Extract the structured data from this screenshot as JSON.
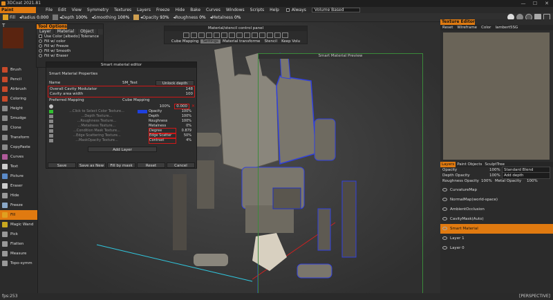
{
  "window": {
    "title": "3DCoat 2021.81",
    "min": "—",
    "max": "☐",
    "close": "✕"
  },
  "menu": {
    "room": "Paint",
    "items": [
      "File",
      "Edit",
      "View",
      "Symmetry",
      "Textures",
      "Layers",
      "Freeze",
      "Hide",
      "Bake",
      "Curves",
      "Windows",
      "Scripts",
      "Help"
    ],
    "always_label": "Always",
    "volume_select": "Volume Based"
  },
  "toolbar": {
    "fill": "Fill",
    "radius_label": "Radius",
    "radius_value": "0.000",
    "depth_label": "Depth",
    "depth_value": "100%",
    "smoothing_label": "Smoothing",
    "smoothing_value": "100%",
    "opacity_label": "Opacity",
    "opacity_value": "93%",
    "roughness_label": "Roughness",
    "roughness_value": "0%",
    "metalness_label": "Metalness",
    "metalness_value": "0%",
    "colors": {
      "accent": "#e07a10"
    }
  },
  "tool_options": {
    "header": "Tool Options",
    "tabs": [
      "Layer",
      "Material",
      "Object"
    ],
    "options": [
      {
        "kind": "checkbox",
        "label": "Use Color [albedo] Tolerance"
      },
      {
        "kind": "radio",
        "label": "Fill  w/  color"
      },
      {
        "kind": "radio",
        "label": "Fill  w/  Freeze"
      },
      {
        "kind": "radio",
        "label": "Fill  w/  Smooth"
      },
      {
        "kind": "radio",
        "label": "Fill  w/  Eraser"
      }
    ]
  },
  "tools": [
    {
      "name": "Brush",
      "icon": "brush-icon",
      "color": "#c84a2a"
    },
    {
      "name": "Pencil",
      "icon": "pencil-icon",
      "color": "#c84a2a"
    },
    {
      "name": "Airbrush",
      "icon": "airbrush-icon",
      "color": "#c84a2a"
    },
    {
      "name": "Coloring",
      "icon": "coloring-icon",
      "color": "#c84a2a"
    },
    {
      "name": "Height",
      "icon": "height-icon",
      "color": "#8a8a8a"
    },
    {
      "name": "Smudge",
      "icon": "smudge-icon",
      "color": "#8a8a8a"
    },
    {
      "name": "Clone",
      "icon": "clone-icon",
      "color": "#8a8a8a"
    },
    {
      "name": "Transform",
      "icon": "transform-icon",
      "color": "#8a8a8a"
    },
    {
      "name": "CopyPaste",
      "icon": "copypaste-icon",
      "color": "#8a8a8a"
    },
    {
      "name": "Curves",
      "icon": "curves-icon",
      "color": "#b05a9a"
    },
    {
      "name": "Text",
      "icon": "text-icon",
      "color": "#cccccc"
    },
    {
      "name": "Picture",
      "icon": "picture-icon",
      "color": "#5a8ac8"
    },
    {
      "name": "Eraser",
      "icon": "eraser-icon",
      "color": "#cccccc"
    },
    {
      "name": "Hide",
      "icon": "hide-icon",
      "color": "#999999"
    },
    {
      "name": "Freeze",
      "icon": "freeze-icon",
      "color": "#8aa8c8"
    },
    {
      "name": "Fill",
      "icon": "fill-icon",
      "color": "#e0a020",
      "active": true
    },
    {
      "name": "Magic Wand",
      "icon": "magic-wand-icon",
      "color": "#c8a820"
    },
    {
      "name": "Pick",
      "icon": "pick-icon",
      "color": "#999999"
    },
    {
      "name": "Flatten",
      "icon": "flatten-icon",
      "color": "#999999"
    },
    {
      "name": "Measure",
      "icon": "measure-icon",
      "color": "#999999"
    },
    {
      "name": "Topo-symm",
      "icon": "topo-symm-icon",
      "color": "#999999"
    }
  ],
  "material_stencil": {
    "title": "Material/stencil control panel",
    "tabs": [
      "Cube Mapping",
      "Settings",
      "Material transforme",
      "Stencil",
      "Keep Volu"
    ],
    "active_tab": 1
  },
  "editor": {
    "title": "Smart material editor",
    "props_title": "Smart Material Properties",
    "name_label": "Name",
    "name_value": "SM_Test",
    "unlock_btn": "Unlock depth",
    "cavity_mod_label": "Overall  Cavity  Modulator",
    "cavity_mod_value": "148",
    "cavity_width_label": "Cavity  area  width",
    "cavity_width_value": "100",
    "pref_label": "Preferred  Mapping",
    "pref_value": "Cube  Mapping",
    "row1_left": "100%",
    "row1_value": "0.000",
    "layers": [
      {
        "left": "...Click to Select Color Texture...",
        "right": "Opacity",
        "value": "100%"
      },
      {
        "left": "...Depth Texture...",
        "right": "Depth",
        "value": "100%"
      },
      {
        "left": "...Roughness Texture...",
        "right": "Roughness",
        "value": "100%"
      },
      {
        "left": "...Metalness Texture...",
        "right": "Metalness",
        "value": "0%"
      },
      {
        "left": "...Condition Mask Texture...",
        "right": "Degree",
        "value": "0.879"
      },
      {
        "left": "...Edge Scattering Texture...",
        "right": "Edge  Scatter",
        "value": "50%"
      },
      {
        "left": "...MaskOpacity Texture...",
        "right": "Contrast",
        "value": "4%"
      }
    ],
    "add_layer": "Add Layer",
    "buttons": [
      "Save",
      "Save as New",
      "Fill by mask",
      "Reset",
      "Cancel"
    ]
  },
  "preview": {
    "title": "Smart Material Preview"
  },
  "texture_editor": {
    "header": "Texture Editor",
    "bar": [
      "Reset",
      "Wireframe",
      "Color",
      "lambert5SG"
    ]
  },
  "layers_panel": {
    "tabs": [
      "Layers",
      "Paint Objects",
      "SculptTree"
    ],
    "opacity_label": "Opacity",
    "opacity_value": "100%",
    "blend_value": "Standard Blend",
    "depth_label": "Depth  Opacity",
    "depth_value": "100%",
    "depth_mode": "Add  depth",
    "rough_label": "Roughness  Opacity",
    "rough_value": "100%",
    "metal_label": "Metal  Opacity",
    "metal_value": "100%",
    "rows": [
      {
        "name": "CurvatureMap",
        "selected": false
      },
      {
        "name": "NormalMap(world-space)",
        "selected": false
      },
      {
        "name": "AmbientOcclusion",
        "selected": false
      },
      {
        "name": "CavityMask(Auto)",
        "selected": false
      },
      {
        "name": "Smart Material",
        "selected": true
      },
      {
        "name": "Layer 1",
        "selected": false
      },
      {
        "name": "Layer 0",
        "selected": false
      }
    ]
  },
  "status": {
    "fps": "fps:253",
    "view": "[PERSPECTIVE]"
  }
}
